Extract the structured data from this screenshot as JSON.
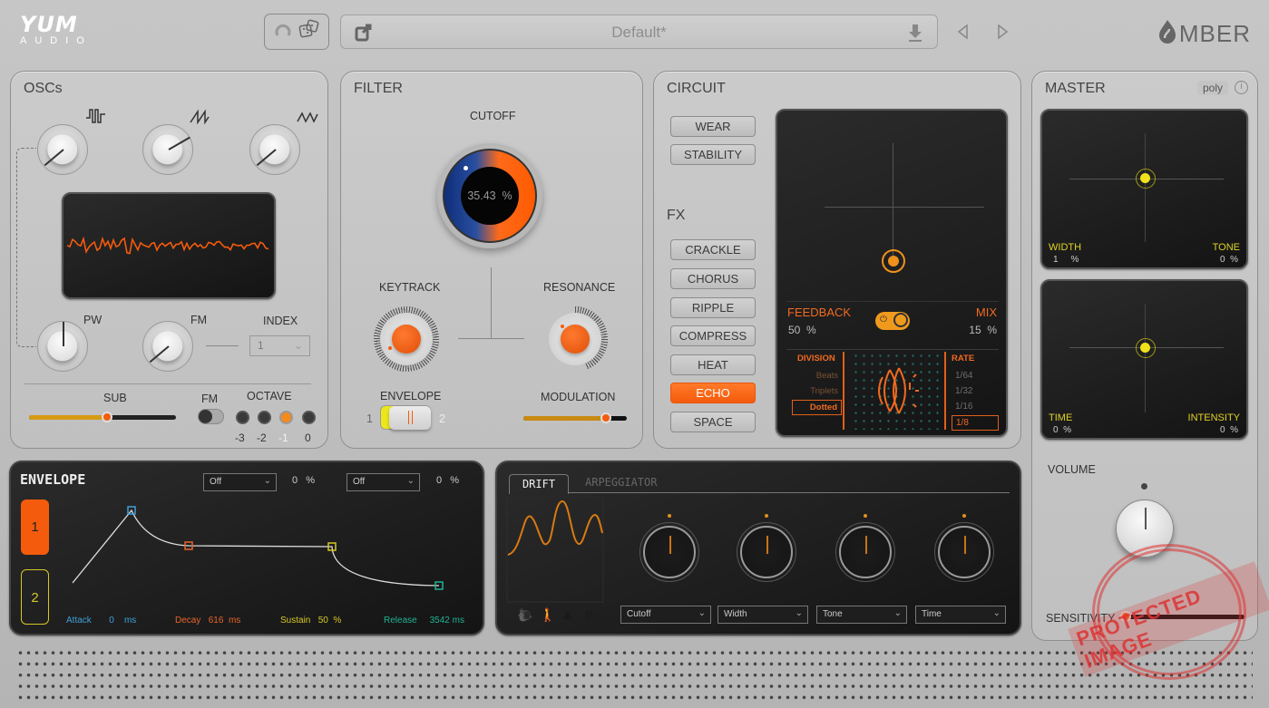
{
  "header": {
    "logo_main": "YUM",
    "logo_sub": "AUDIO",
    "preset_name": "Default*",
    "brand": "MBER",
    "icons": [
      "reset-icon",
      "dice-icon",
      "share-icon",
      "download-icon",
      "prev-arrow-icon",
      "next-arrow-icon",
      "flame-logo-icon"
    ]
  },
  "oscs": {
    "title": "OSCs",
    "wave_icons": [
      "square-wave-icon",
      "saw-wave-icon",
      "triangle-wave-icon"
    ],
    "pw_label": "PW",
    "fm_label": "FM",
    "index_label": "INDEX",
    "index_value": "1",
    "sub_label": "SUB",
    "sub_value": 0.53,
    "fm_toggle_label": "FM",
    "octave_label": "OCTAVE",
    "octave_options": [
      "-3",
      "-2",
      "-1",
      "0"
    ],
    "octave_selected": "-1"
  },
  "filter": {
    "title": "FILTER",
    "cutoff_label": "CUTOFF",
    "cutoff_value": "35.43",
    "cutoff_unit": "%",
    "keytrack_label": "KEYTRACK",
    "resonance_label": "RESONANCE",
    "envelope_label": "ENVELOPE",
    "envelope_opt1": "1",
    "envelope_opt2": "2",
    "modulation_label": "MODULATION",
    "modulation_value": 0.8
  },
  "circuit": {
    "title": "CIRCUIT",
    "buttons": [
      "WEAR",
      "STABILITY"
    ],
    "fx_title": "FX",
    "fx_buttons": [
      "CRACKLE",
      "CHORUS",
      "RIPPLE",
      "COMPRESS",
      "HEAT",
      "ECHO",
      "SPACE"
    ],
    "fx_active": "ECHO",
    "feedback_label": "FEEDBACK",
    "feedback_value": "50",
    "mix_label": "MIX",
    "mix_value": "15",
    "unit": "%",
    "division_label": "DIVISION",
    "division_options": [
      "Beats",
      "Triplets",
      "Dotted"
    ],
    "division_selected": "Dotted",
    "rate_label": "RATE",
    "rate_options": [
      "1/64",
      "1/32",
      "1/16",
      "1/8"
    ],
    "rate_selected": "1/8"
  },
  "master": {
    "title": "MASTER",
    "mode": "poly",
    "pad1": {
      "x_label": "WIDTH",
      "x_value": "1",
      "y_label": "TONE",
      "y_value": "0",
      "unit": "%"
    },
    "pad2": {
      "x_label": "TIME",
      "x_value": "0",
      "y_label": "INTENSITY",
      "y_value": "0",
      "unit": "%"
    },
    "volume_label": "VOLUME",
    "sensitivity_label": "SENSITIVITY"
  },
  "envelope": {
    "title": "ENVELOPE",
    "env1_label": "1",
    "env2_label": "2",
    "dest1": "Off",
    "dest1_amount": "0",
    "dest2": "Off",
    "dest2_amount": "0",
    "unit": "%",
    "attack_label": "Attack",
    "attack_value": "0",
    "attack_unit": "ms",
    "decay_label": "Decay",
    "decay_value": "616",
    "decay_unit": "ms",
    "sustain_label": "Sustain",
    "sustain_value": "50",
    "sustain_unit": "%",
    "release_label": "Release",
    "release_value": "3542",
    "release_unit": "ms"
  },
  "drift": {
    "tabs": [
      "DRIFT",
      "ARPEGGIATOR"
    ],
    "active_tab": "DRIFT",
    "mode_icons": [
      "snail-icon",
      "hiker-icon",
      "mountain-icon",
      "bed-icon"
    ],
    "active_mode": "hiker-icon",
    "targets": [
      "Cutoff",
      "Width",
      "Tone",
      "Time"
    ]
  },
  "watermark": "PROTECTED IMAGE",
  "colors": {
    "accent": "#f55b0c",
    "yellow": "#e1d325",
    "attack": "#3ea0d8",
    "decay": "#e8652a",
    "sustain": "#d6c827",
    "release": "#1fb394"
  }
}
